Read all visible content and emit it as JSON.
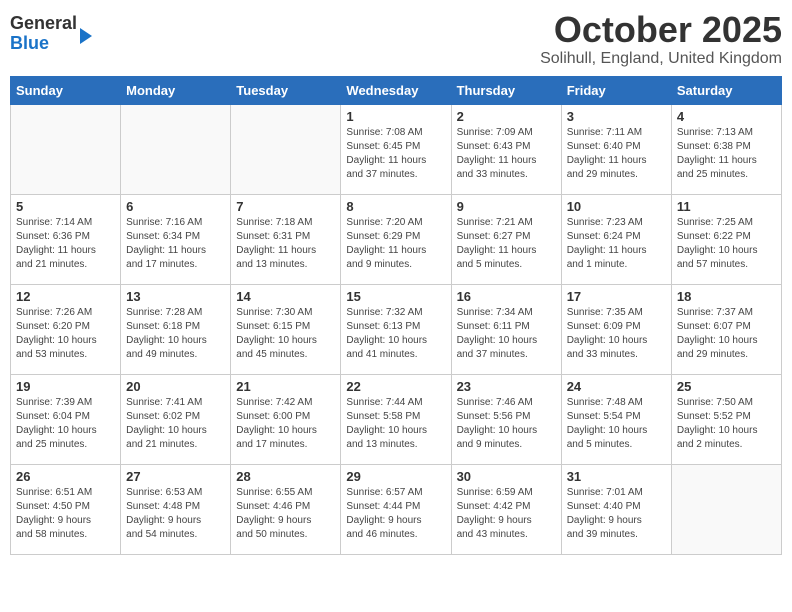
{
  "header": {
    "logo_general": "General",
    "logo_blue": "Blue",
    "month_title": "October 2025",
    "location": "Solihull, England, United Kingdom"
  },
  "weekdays": [
    "Sunday",
    "Monday",
    "Tuesday",
    "Wednesday",
    "Thursday",
    "Friday",
    "Saturday"
  ],
  "weeks": [
    [
      {
        "day": "",
        "info": ""
      },
      {
        "day": "",
        "info": ""
      },
      {
        "day": "",
        "info": ""
      },
      {
        "day": "1",
        "info": "Sunrise: 7:08 AM\nSunset: 6:45 PM\nDaylight: 11 hours\nand 37 minutes."
      },
      {
        "day": "2",
        "info": "Sunrise: 7:09 AM\nSunset: 6:43 PM\nDaylight: 11 hours\nand 33 minutes."
      },
      {
        "day": "3",
        "info": "Sunrise: 7:11 AM\nSunset: 6:40 PM\nDaylight: 11 hours\nand 29 minutes."
      },
      {
        "day": "4",
        "info": "Sunrise: 7:13 AM\nSunset: 6:38 PM\nDaylight: 11 hours\nand 25 minutes."
      }
    ],
    [
      {
        "day": "5",
        "info": "Sunrise: 7:14 AM\nSunset: 6:36 PM\nDaylight: 11 hours\nand 21 minutes."
      },
      {
        "day": "6",
        "info": "Sunrise: 7:16 AM\nSunset: 6:34 PM\nDaylight: 11 hours\nand 17 minutes."
      },
      {
        "day": "7",
        "info": "Sunrise: 7:18 AM\nSunset: 6:31 PM\nDaylight: 11 hours\nand 13 minutes."
      },
      {
        "day": "8",
        "info": "Sunrise: 7:20 AM\nSunset: 6:29 PM\nDaylight: 11 hours\nand 9 minutes."
      },
      {
        "day": "9",
        "info": "Sunrise: 7:21 AM\nSunset: 6:27 PM\nDaylight: 11 hours\nand 5 minutes."
      },
      {
        "day": "10",
        "info": "Sunrise: 7:23 AM\nSunset: 6:24 PM\nDaylight: 11 hours\nand 1 minute."
      },
      {
        "day": "11",
        "info": "Sunrise: 7:25 AM\nSunset: 6:22 PM\nDaylight: 10 hours\nand 57 minutes."
      }
    ],
    [
      {
        "day": "12",
        "info": "Sunrise: 7:26 AM\nSunset: 6:20 PM\nDaylight: 10 hours\nand 53 minutes."
      },
      {
        "day": "13",
        "info": "Sunrise: 7:28 AM\nSunset: 6:18 PM\nDaylight: 10 hours\nand 49 minutes."
      },
      {
        "day": "14",
        "info": "Sunrise: 7:30 AM\nSunset: 6:15 PM\nDaylight: 10 hours\nand 45 minutes."
      },
      {
        "day": "15",
        "info": "Sunrise: 7:32 AM\nSunset: 6:13 PM\nDaylight: 10 hours\nand 41 minutes."
      },
      {
        "day": "16",
        "info": "Sunrise: 7:34 AM\nSunset: 6:11 PM\nDaylight: 10 hours\nand 37 minutes."
      },
      {
        "day": "17",
        "info": "Sunrise: 7:35 AM\nSunset: 6:09 PM\nDaylight: 10 hours\nand 33 minutes."
      },
      {
        "day": "18",
        "info": "Sunrise: 7:37 AM\nSunset: 6:07 PM\nDaylight: 10 hours\nand 29 minutes."
      }
    ],
    [
      {
        "day": "19",
        "info": "Sunrise: 7:39 AM\nSunset: 6:04 PM\nDaylight: 10 hours\nand 25 minutes."
      },
      {
        "day": "20",
        "info": "Sunrise: 7:41 AM\nSunset: 6:02 PM\nDaylight: 10 hours\nand 21 minutes."
      },
      {
        "day": "21",
        "info": "Sunrise: 7:42 AM\nSunset: 6:00 PM\nDaylight: 10 hours\nand 17 minutes."
      },
      {
        "day": "22",
        "info": "Sunrise: 7:44 AM\nSunset: 5:58 PM\nDaylight: 10 hours\nand 13 minutes."
      },
      {
        "day": "23",
        "info": "Sunrise: 7:46 AM\nSunset: 5:56 PM\nDaylight: 10 hours\nand 9 minutes."
      },
      {
        "day": "24",
        "info": "Sunrise: 7:48 AM\nSunset: 5:54 PM\nDaylight: 10 hours\nand 5 minutes."
      },
      {
        "day": "25",
        "info": "Sunrise: 7:50 AM\nSunset: 5:52 PM\nDaylight: 10 hours\nand 2 minutes."
      }
    ],
    [
      {
        "day": "26",
        "info": "Sunrise: 6:51 AM\nSunset: 4:50 PM\nDaylight: 9 hours\nand 58 minutes."
      },
      {
        "day": "27",
        "info": "Sunrise: 6:53 AM\nSunset: 4:48 PM\nDaylight: 9 hours\nand 54 minutes."
      },
      {
        "day": "28",
        "info": "Sunrise: 6:55 AM\nSunset: 4:46 PM\nDaylight: 9 hours\nand 50 minutes."
      },
      {
        "day": "29",
        "info": "Sunrise: 6:57 AM\nSunset: 4:44 PM\nDaylight: 9 hours\nand 46 minutes."
      },
      {
        "day": "30",
        "info": "Sunrise: 6:59 AM\nSunset: 4:42 PM\nDaylight: 9 hours\nand 43 minutes."
      },
      {
        "day": "31",
        "info": "Sunrise: 7:01 AM\nSunset: 4:40 PM\nDaylight: 9 hours\nand 39 minutes."
      },
      {
        "day": "",
        "info": ""
      }
    ]
  ]
}
